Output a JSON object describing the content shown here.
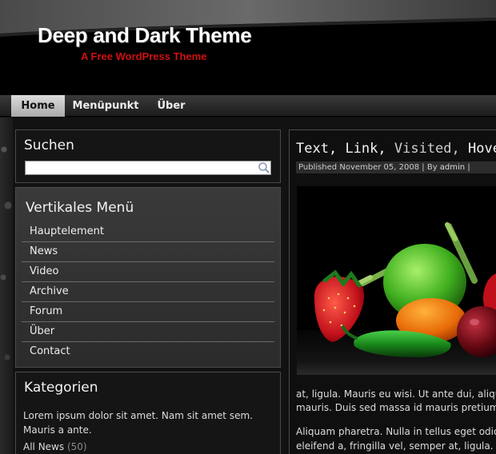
{
  "header": {
    "title": "Deep and Dark Theme",
    "tagline": "A Free WordPress Theme"
  },
  "nav": {
    "tabs": [
      {
        "label": "Home",
        "active": true
      },
      {
        "label": "Menüpunkt",
        "active": false
      },
      {
        "label": "Über",
        "active": false
      }
    ]
  },
  "search": {
    "title": "Suchen",
    "value": ""
  },
  "menu": {
    "title": "Vertikales Menü",
    "items": [
      "Hauptelement",
      "News",
      "Video",
      "Archive",
      "Forum",
      "Über",
      "Contact"
    ]
  },
  "categories": {
    "title": "Kategorien",
    "description": "Lorem ipsum dolor sit amet. Nam sit amet sem. Mauris a ante.",
    "link_label": "All News",
    "link_count": "(50)"
  },
  "post": {
    "title_parts": {
      "text": "Text,",
      "link": "Link,",
      "visited": "Visited,",
      "hovered": "Hovered"
    },
    "meta": {
      "published_label": "Published",
      "date": "November 05, 2008",
      "separator": "|",
      "by_label": "By",
      "author": "admin",
      "trailing": "|"
    },
    "paragraph1_line1": "at, ligula. Mauris eu wisi. Ut ante dui, aliquet",
    "paragraph1_line2": "mauris. Duis sed massa id mauris pretium",
    "paragraph2_line1": "Aliquam pharetra. Nulla in tellus eget odio",
    "paragraph2_line2": "eleifend a, fringilla vel, semper at, ligula."
  },
  "colors": {
    "tagline": "#d01010",
    "nav_active_bg": "#c8c8c8"
  },
  "icons": {
    "search": "magnifier-icon"
  }
}
